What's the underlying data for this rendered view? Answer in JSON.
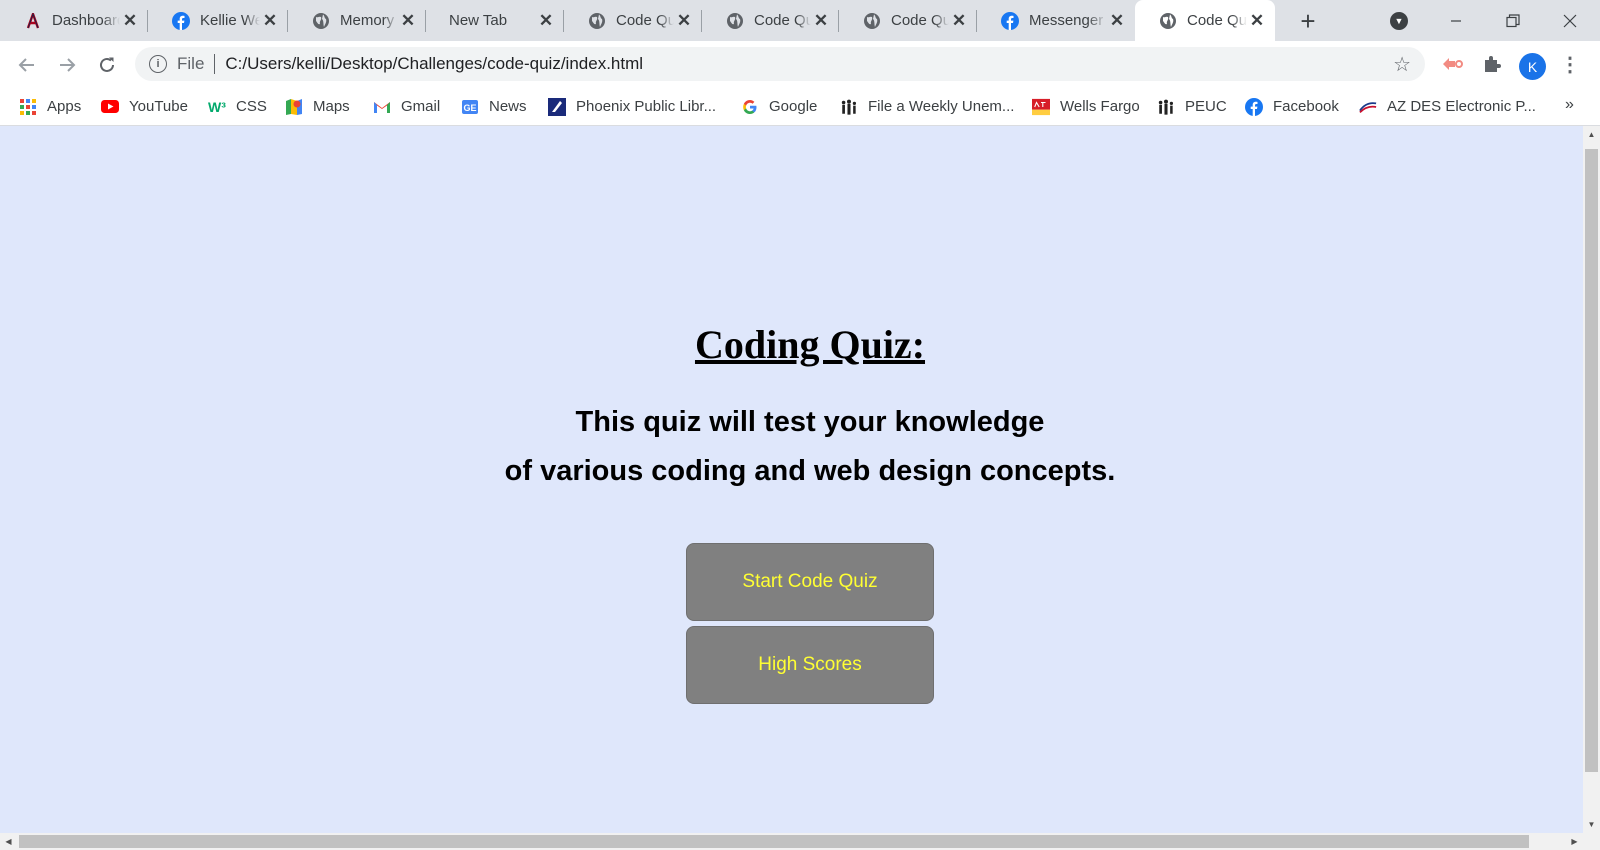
{
  "tabs": [
    {
      "title": "Dashboard",
      "icon": "arizona-logo-icon"
    },
    {
      "title": "Kellie Wells",
      "icon": "facebook-icon"
    },
    {
      "title": "Memory Game",
      "icon": "globe-icon"
    },
    {
      "title": "New Tab",
      "icon": ""
    },
    {
      "title": "Code Quiz",
      "icon": "globe-icon"
    },
    {
      "title": "Code Quiz",
      "icon": "globe-icon"
    },
    {
      "title": "Code Quiz",
      "icon": "globe-icon"
    },
    {
      "title": "Messenger",
      "icon": "facebook-icon"
    },
    {
      "title": "Code Quiz",
      "icon": "globe-icon",
      "active": true
    }
  ],
  "toolbar": {
    "scheme_label": "File",
    "url": "C:/Users/kelli/Desktop/Challenges/code-quiz/index.html",
    "profile_initial": "K"
  },
  "bookmarks": [
    {
      "label": "Apps",
      "icon": "apps-grid-icon"
    },
    {
      "label": "YouTube",
      "icon": "youtube-icon"
    },
    {
      "label": "CSS",
      "icon": "w3schools-icon"
    },
    {
      "label": "Maps",
      "icon": "maps-icon"
    },
    {
      "label": "Gmail",
      "icon": "gmail-icon"
    },
    {
      "label": "News",
      "icon": "google-news-icon"
    },
    {
      "label": "Phoenix Public Libr...",
      "icon": "library-icon"
    },
    {
      "label": "Google",
      "icon": "google-icon"
    },
    {
      "label": "File a Weekly Unem...",
      "icon": "people-icon"
    },
    {
      "label": "Wells Fargo",
      "icon": "wells-fargo-icon"
    },
    {
      "label": "PEUC",
      "icon": "people-icon"
    },
    {
      "label": "Facebook",
      "icon": "facebook-icon"
    },
    {
      "label": "AZ DES Electronic P...",
      "icon": "az-des-icon"
    }
  ],
  "page": {
    "title": "Coding Quiz:",
    "subtitle_line1": "This quiz will test your knowledge",
    "subtitle_line2": "of various coding and web design concepts.",
    "start_button": "Start Code Quiz",
    "scores_button": "High Scores"
  },
  "colors": {
    "page_background": "#dfe7fb",
    "button_background": "#808080",
    "button_text": "#ffff33"
  }
}
